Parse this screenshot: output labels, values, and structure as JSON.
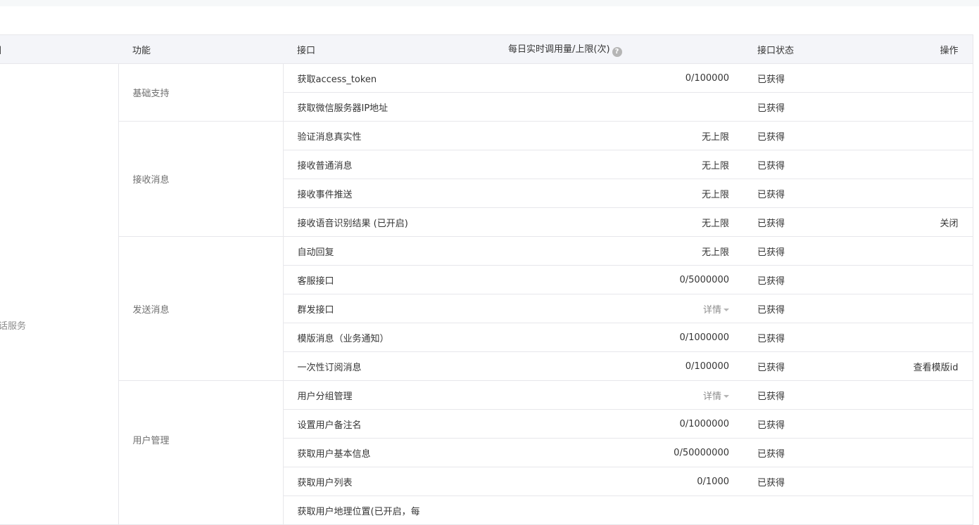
{
  "table": {
    "headers": {
      "category": "目",
      "feature": "功能",
      "api": "接口",
      "quota": "每日实时调用量/上限(次)",
      "status": "接口状态",
      "action": "操作"
    },
    "category_label": "话服务",
    "groups": {
      "basic": "基础支持",
      "receive": "接收消息",
      "send": "发送消息",
      "user": "用户管理"
    },
    "rows": [
      {
        "api": "获取access_token",
        "quota": "0/100000",
        "status": "已获得",
        "action": ""
      },
      {
        "api": "获取微信服务器IP地址",
        "quota": "",
        "status": "已获得",
        "action": ""
      },
      {
        "api": "验证消息真实性",
        "quota": "无上限",
        "status": "已获得",
        "action": ""
      },
      {
        "api": "接收普通消息",
        "quota": "无上限",
        "status": "已获得",
        "action": ""
      },
      {
        "api": "接收事件推送",
        "quota": "无上限",
        "status": "已获得",
        "action": ""
      },
      {
        "api": "接收语音识别结果 (已开启)",
        "quota": "无上限",
        "status": "已获得",
        "action": "关闭"
      },
      {
        "api": "自动回复",
        "quota": "无上限",
        "status": "已获得",
        "action": ""
      },
      {
        "api": "客服接口",
        "quota": "0/5000000",
        "status": "已获得",
        "action": ""
      },
      {
        "api": "群发接口",
        "quota": "详情",
        "status": "已获得",
        "action": ""
      },
      {
        "api": "模版消息（业务通知）",
        "quota": "0/1000000",
        "status": "已获得",
        "action": ""
      },
      {
        "api": "一次性订阅消息",
        "quota": "0/100000",
        "status": "已获得",
        "action": "查看模版id"
      },
      {
        "api": "用户分组管理",
        "quota": "详情",
        "status": "已获得",
        "action": ""
      },
      {
        "api": "设置用户备注名",
        "quota": "0/1000000",
        "status": "已获得",
        "action": ""
      },
      {
        "api": "获取用户基本信息",
        "quota": "0/50000000",
        "status": "已获得",
        "action": ""
      },
      {
        "api": "获取用户列表",
        "quota": "0/1000",
        "status": "已获得",
        "action": ""
      },
      {
        "api": "获取用户地理位置(已开启，每",
        "quota": "",
        "status": "",
        "action": ""
      }
    ]
  },
  "icons": {
    "help": "question-circle-icon",
    "dropdown": "caret-down-icon"
  },
  "colors": {
    "header_bg": "#f4f5f9",
    "border": "#e7e7eb",
    "muted_text": "#8d8d8d"
  }
}
